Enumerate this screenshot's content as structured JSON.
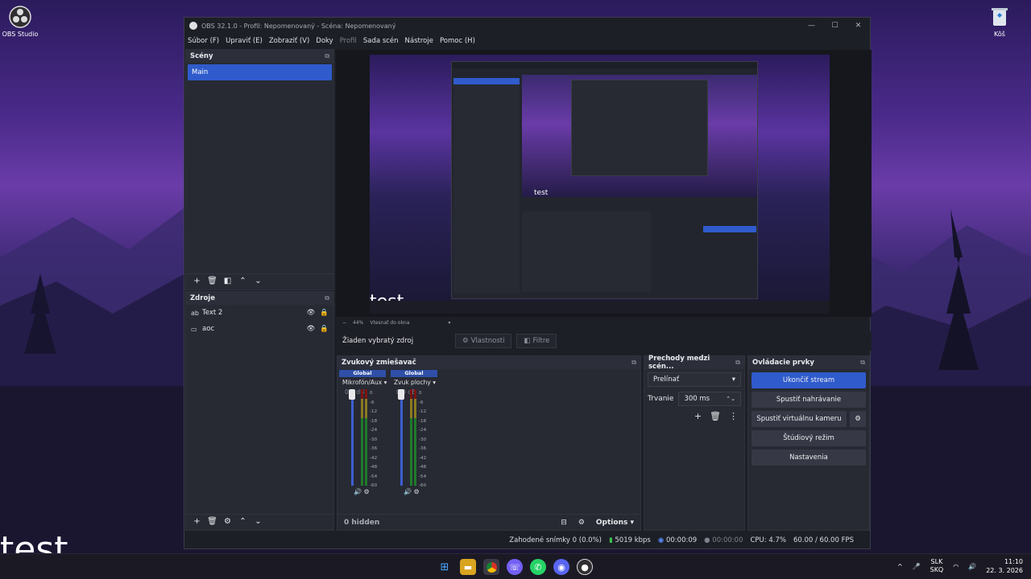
{
  "desktop": {
    "obs_icon_label": "OBS Studio",
    "bin_label": "Kôš",
    "big_text": "test"
  },
  "window": {
    "title": "OBS 32.1.0 - Profil: Nepomenovaný - Scéna: Nepomenovaný",
    "controls": [
      "—",
      "☐",
      "✕"
    ]
  },
  "menu": {
    "items": [
      "Súbor (F)",
      "Upraviť (E)",
      "Zobraziť (V)",
      "Doky",
      "Profil",
      "Sada scén",
      "Nástroje",
      "Pomoc (H)"
    ]
  },
  "scenes": {
    "title": "Scény",
    "items": [
      "Main"
    ]
  },
  "sources": {
    "title": "Zdroje",
    "items": [
      {
        "label": "Text 2",
        "icon": "text-icon"
      },
      {
        "label": "aoc",
        "icon": "monitor-icon"
      }
    ]
  },
  "preview": {
    "nested_test": "test",
    "zoom": "44%",
    "zoom_mode": "Vtesnať do okna"
  },
  "source_bar": {
    "no_source": "Žiaden vybratý zdroj",
    "properties": "Vlastnosti",
    "filters": "Filtre"
  },
  "mixer": {
    "title": "Zvukový zmiešavač",
    "channels": [
      {
        "group": "Global",
        "name": "Mikrofón/Aux",
        "db": "0.0 dB"
      },
      {
        "group": "Global",
        "name": "Zvuk plochy",
        "db": "0.0 dB"
      }
    ],
    "scale": [
      "0",
      "-6",
      "-12",
      "-18",
      "-24",
      "-30",
      "-36",
      "-42",
      "-48",
      "-54",
      "-60"
    ],
    "hidden": "0 hidden",
    "options": "Options"
  },
  "transitions": {
    "title": "Prechody medzi scén...",
    "selected": "Prelínať",
    "duration_label": "Trvanie",
    "duration_value": "300 ms"
  },
  "controls": {
    "title": "Ovládacie prvky",
    "stop_stream": "Ukončiť stream",
    "start_recording": "Spustiť nahrávanie",
    "start_vcam": "Spustiť virtuálnu kameru",
    "studio_mode": "Štúdiový režim",
    "settings": "Nastavenia"
  },
  "status": {
    "dropped": "Zahodené snímky 0 (0.0%)",
    "bitrate": "5019 kbps",
    "stream_time": "00:00:09",
    "rec_time": "00:00:00",
    "cpu": "CPU: 4.7%",
    "fps": "60.00 / 60.00 FPS"
  },
  "taskbar": {
    "lang_top": "SLK",
    "lang_bottom": "SKQ",
    "time": "11:10",
    "date": "22. 3. 2026"
  },
  "colors": {
    "accent": "#2f5bcc",
    "panel": "#272a33",
    "window_bg": "#1d1f26"
  }
}
